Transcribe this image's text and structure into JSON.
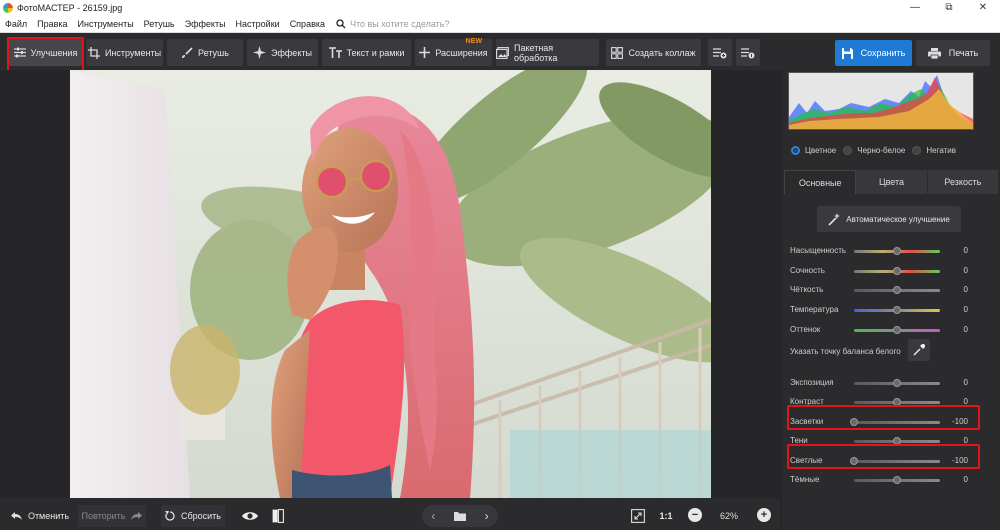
{
  "window": {
    "title": "ФотоМАСТЕР - 26159.jpg"
  },
  "menu": {
    "items": [
      "Файл",
      "Правка",
      "Инструменты",
      "Ретушь",
      "Эффекты",
      "Настройки",
      "Справка"
    ],
    "search_placeholder": "Что вы хотите сделать?"
  },
  "toolbar": {
    "improvements": "Улучшения",
    "tools": "Инструменты",
    "retouch": "Ретушь",
    "effects": "Эффекты",
    "text_frames": "Текст и рамки",
    "extensions": "Расширения",
    "extensions_badge": "NEW",
    "batch": "Пакетная обработка",
    "collage": "Создать коллаж",
    "save": "Сохранить",
    "print": "Печать"
  },
  "bottom": {
    "undo": "Отменить",
    "redo": "Повторить",
    "reset": "Сбросить",
    "ratio": "1:1",
    "zoom": "62%"
  },
  "panel": {
    "color_modes": [
      {
        "label": "Цветное",
        "selected": true
      },
      {
        "label": "Черно-белое",
        "selected": false
      },
      {
        "label": "Негатив",
        "selected": false
      }
    ],
    "tabs": [
      {
        "label": "Основные",
        "active": true
      },
      {
        "label": "Цвета",
        "active": false
      },
      {
        "label": "Резкость",
        "active": false
      }
    ],
    "auto_button": "Автоматическое улучшение",
    "white_balance_label": "Указать точку баланса белого",
    "sliders": [
      {
        "label": "Насыщенность",
        "value": "0",
        "level": 0.5,
        "gradient": "saturation"
      },
      {
        "label": "Сочность",
        "value": "0",
        "level": 0.5,
        "gradient": "saturation"
      },
      {
        "label": "Чёткость",
        "value": "0",
        "level": 0.5,
        "gradient": "gray"
      },
      {
        "label": "Температура",
        "value": "0",
        "level": 0.5,
        "gradient": "temperature"
      },
      {
        "label": "Оттенок",
        "value": "0",
        "level": 0.5,
        "gradient": "tint"
      },
      {
        "label": "Экспозиция",
        "value": "0",
        "level": 0.5,
        "gradient": "gray"
      },
      {
        "label": "Контраст",
        "value": "0",
        "level": 0.5,
        "gradient": "gray"
      },
      {
        "label": "Засветки",
        "value": "-100",
        "level": 0.0,
        "gradient": "gray"
      },
      {
        "label": "Тени",
        "value": "0",
        "level": 0.5,
        "gradient": "gray"
      },
      {
        "label": "Светлые",
        "value": "-100",
        "level": 0.0,
        "gradient": "gray"
      },
      {
        "label": "Тёмные",
        "value": "0",
        "level": 0.5,
        "gradient": "gray"
      }
    ]
  },
  "colors": {
    "accent": "#1f7ad6",
    "highlight_box": "#e0161b"
  }
}
